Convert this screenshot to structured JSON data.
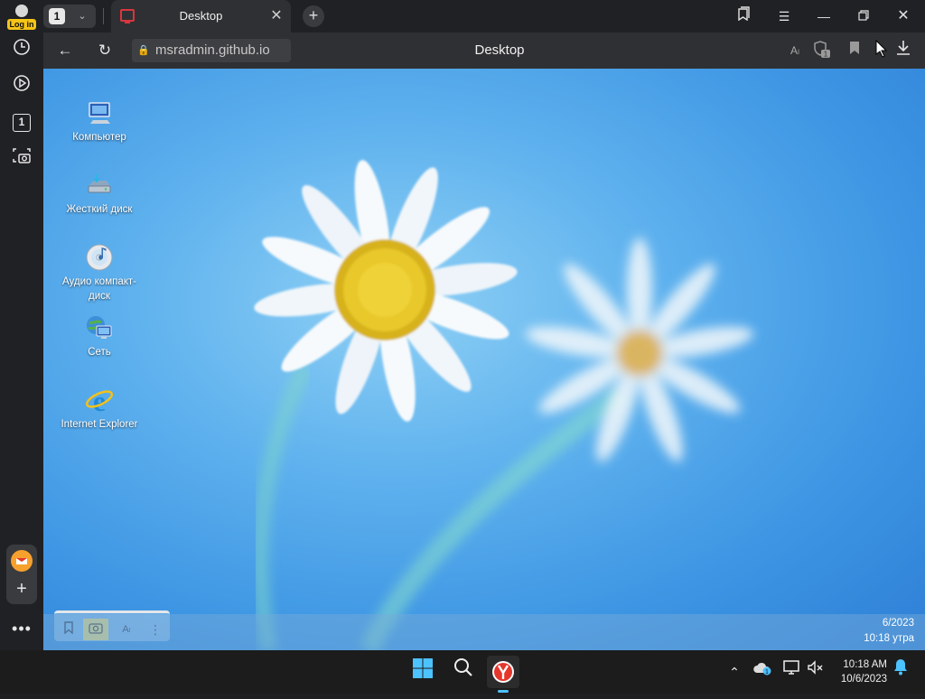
{
  "browser": {
    "profile_badge": "Log in",
    "tab_count": "1",
    "active_tab_title": "Desktop",
    "address_url": "msradmin.github.io",
    "page_title": "Desktop"
  },
  "sidebar": {
    "items": [
      {
        "icon": "history-icon"
      },
      {
        "icon": "play-icon"
      },
      {
        "icon": "tabs-count-icon",
        "label": "1"
      },
      {
        "icon": "screenshot-icon"
      }
    ]
  },
  "desktop": {
    "icons": [
      {
        "label": "Компьютер",
        "icon": "computer-icon"
      },
      {
        "label": "Жесткий диск",
        "icon": "hard-drive-icon"
      },
      {
        "label": "Аудио компакт-диск",
        "icon": "audio-cd-icon"
      },
      {
        "label": "Сеть",
        "icon": "network-icon"
      },
      {
        "label": "Internet Explorer",
        "icon": "internet-explorer-icon"
      }
    ],
    "clock_date": "6/2023",
    "clock_time": "10:18 утра"
  },
  "taskbar": {
    "time": "10:18 AM",
    "date": "10/6/2023",
    "tray_badge": "1"
  },
  "colors": {
    "browser_bg": "#202124",
    "desktop_blue": "#3d95e3",
    "badge_yellow": "#f5c518",
    "accent_red": "#d9363e"
  }
}
